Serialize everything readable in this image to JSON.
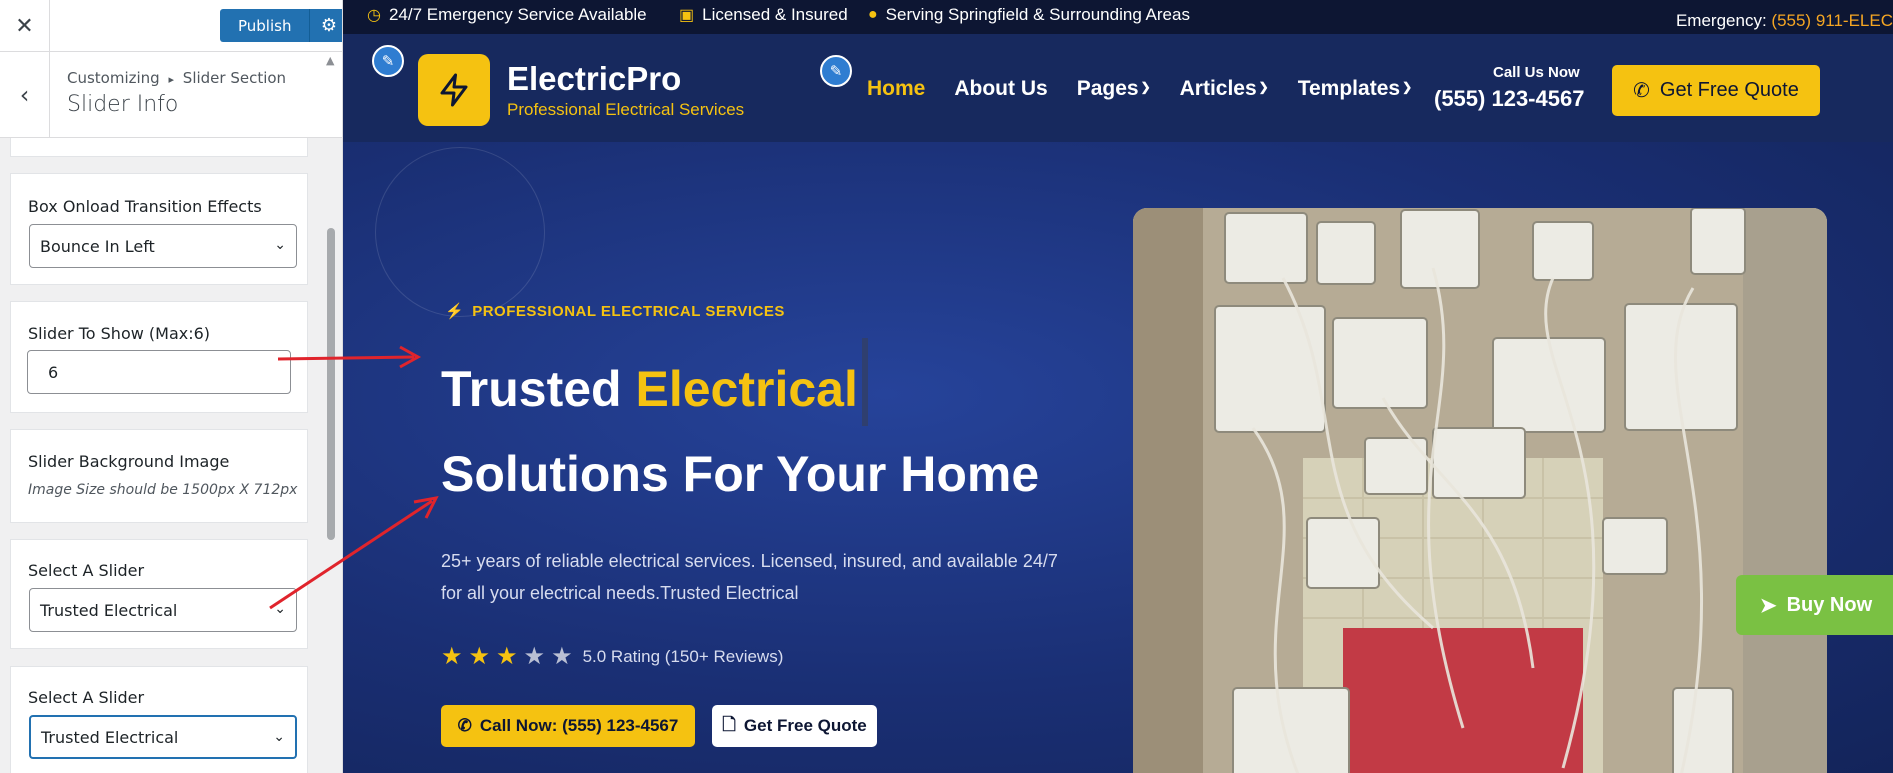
{
  "customizer": {
    "close_icon": "close-icon",
    "publish_label": "Publish",
    "settings_icon": "gear-icon",
    "breadcrumb_root": "Customizing",
    "breadcrumb_sep": "▸",
    "breadcrumb_section": "Slider Section",
    "panel_title": "Slider Info",
    "fields": {
      "transition": {
        "label": "Box Onload Transition Effects",
        "value": "Bounce In Left"
      },
      "slider_count": {
        "label": "Slider To Show (Max:6)",
        "value": "6"
      },
      "background": {
        "label": "Slider Background Image",
        "hint": "Image Size should be 1500px X 712px"
      },
      "select_1": {
        "label": "Select A Slider",
        "value": "Trusted Electrical"
      },
      "select_2": {
        "label": "Select A Slider",
        "value": "Trusted Electrical"
      }
    }
  },
  "site": {
    "topbar": {
      "emergency_service": "24/7 Emergency Service Available",
      "licensed": "Licensed & Insured",
      "serving": "Serving Springfield & Surrounding Areas",
      "emergency_label": "Emergency:",
      "emergency_number": "(555) 911-ELEC"
    },
    "brand": {
      "name": "ElectricPro",
      "tagline": "Professional Electrical Services"
    },
    "nav": [
      {
        "label": "Home",
        "active": true
      },
      {
        "label": "About Us"
      },
      {
        "label": "Pages",
        "dropdown": true
      },
      {
        "label": "Articles",
        "dropdown": true
      },
      {
        "label": "Templates",
        "dropdown": true
      }
    ],
    "call": {
      "label": "Call Us Now",
      "number": "(555) 123-4567"
    },
    "header_cta": "Get Free Quote",
    "hero": {
      "eyebrow": "PROFESSIONAL ELECTRICAL SERVICES",
      "title_line1_plain": "Trusted ",
      "title_line1_highlight": "Electrical",
      "title_line2": "Solutions For Your Home",
      "description": "25+ years of reliable electrical services. Licensed, insured, and available 24/7 for all your electrical needs.Trusted Electrical",
      "rating_stars": 3,
      "rating_max": 5,
      "rating_text": "5.0 Rating (150+ Reviews)",
      "cta_call": "Call Now: (555) 123-4567",
      "cta_quote": "Get Free Quote"
    },
    "buy_now": "Buy Now"
  },
  "colors": {
    "accent": "#f5c211",
    "navy": "#17295e",
    "wp_blue": "#2271b1",
    "buy_green": "#7ac143",
    "annotation_red": "#e0242c"
  }
}
